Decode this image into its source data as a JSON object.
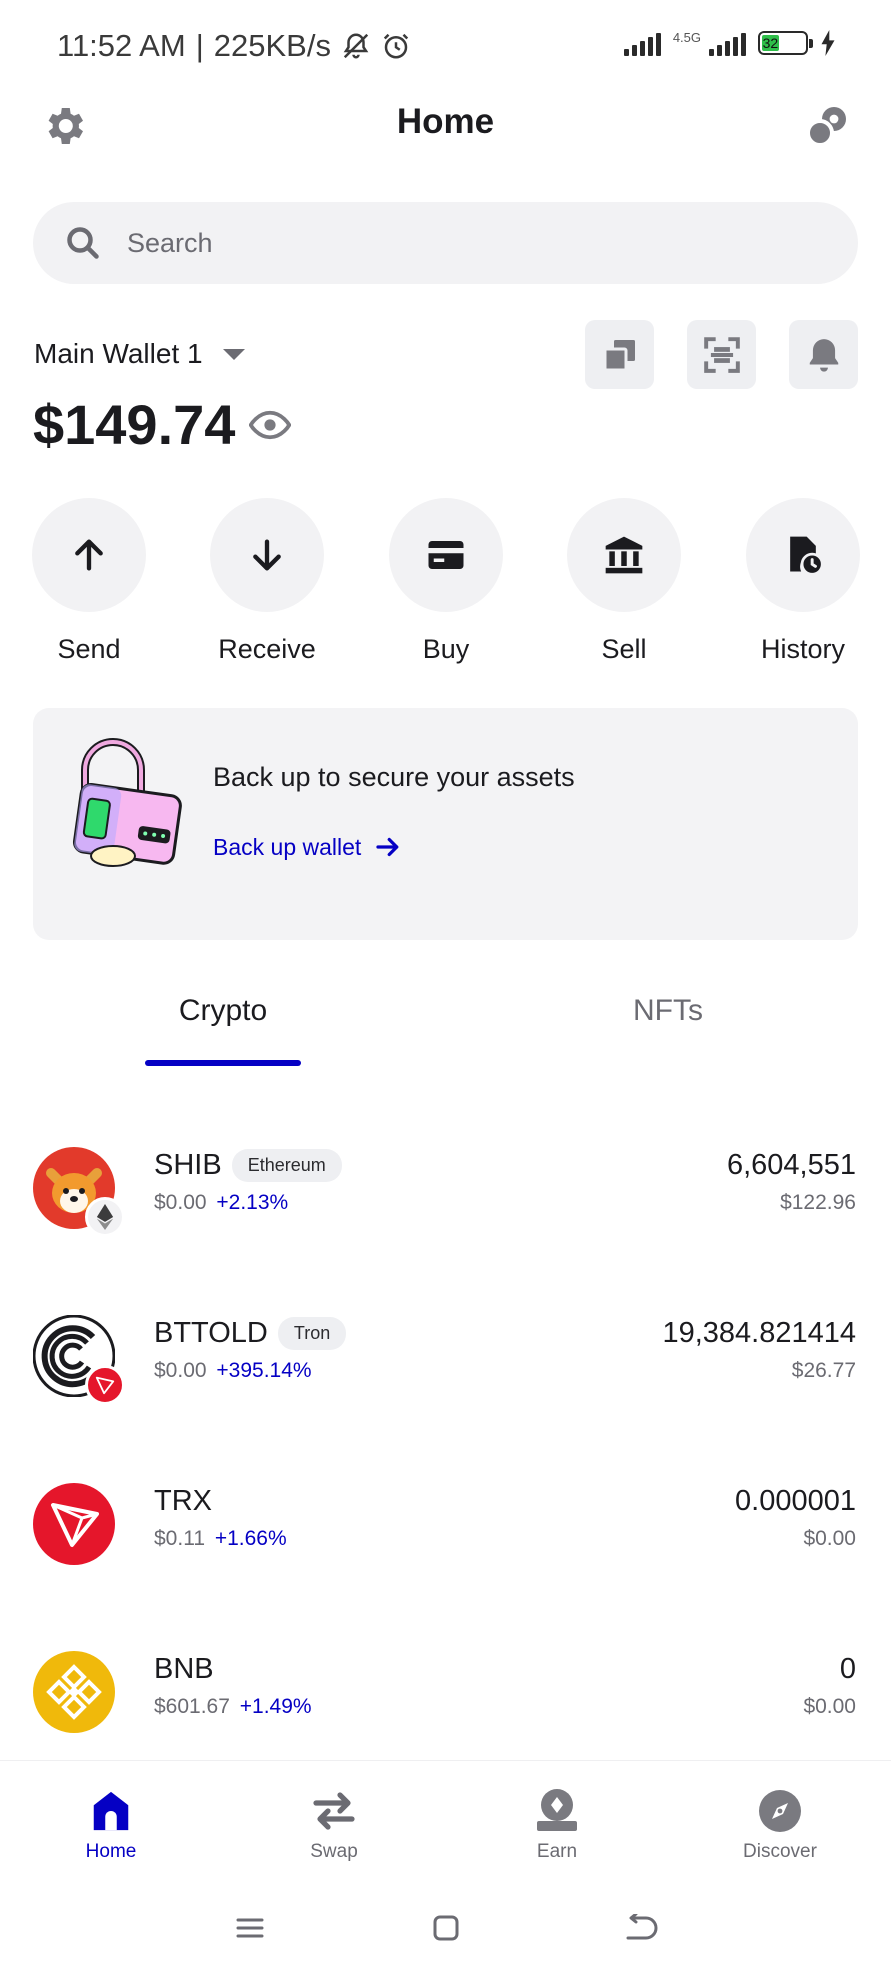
{
  "status_bar": {
    "time": "11:52 AM",
    "separator": "|",
    "speed": "225KB/s",
    "network": "4.5G",
    "battery": "32"
  },
  "header": {
    "title": "Home"
  },
  "search": {
    "placeholder": "Search"
  },
  "wallet": {
    "name": "Main Wallet 1",
    "balance": "$149.74"
  },
  "actions": [
    {
      "label": "Send",
      "icon": "arrow-up-icon"
    },
    {
      "label": "Receive",
      "icon": "arrow-down-icon"
    },
    {
      "label": "Buy",
      "icon": "card-icon"
    },
    {
      "label": "Sell",
      "icon": "bank-icon"
    },
    {
      "label": "History",
      "icon": "history-icon"
    }
  ],
  "backup": {
    "title": "Back up to secure your assets",
    "link": "Back up wallet"
  },
  "tabs": {
    "crypto": "Crypto",
    "nfts": "NFTs",
    "active": "Crypto"
  },
  "assets": [
    {
      "symbol": "SHIB",
      "chain": "Ethereum",
      "price": "$0.00",
      "change": "+2.13%",
      "quantity": "6,604,551",
      "fiat": "$122.96"
    },
    {
      "symbol": "BTTOLD",
      "chain": "Tron",
      "price": "$0.00",
      "change": "+395.14%",
      "quantity": "19,384.821414",
      "fiat": "$26.77"
    },
    {
      "symbol": "TRX",
      "chain": "",
      "price": "$0.11",
      "change": "+1.66%",
      "quantity": "0.000001",
      "fiat": "$0.00"
    },
    {
      "symbol": "BNB",
      "chain": "",
      "price": "$601.67",
      "change": "+1.49%",
      "quantity": "0",
      "fiat": "$0.00"
    }
  ],
  "bottom_nav": [
    {
      "label": "Home",
      "active": true
    },
    {
      "label": "Swap",
      "active": false
    },
    {
      "label": "Earn",
      "active": false
    },
    {
      "label": "Discover",
      "active": false
    }
  ],
  "colors": {
    "accent": "#0500c4",
    "muted": "#6b6b72",
    "surface": "#f2f2f4"
  }
}
